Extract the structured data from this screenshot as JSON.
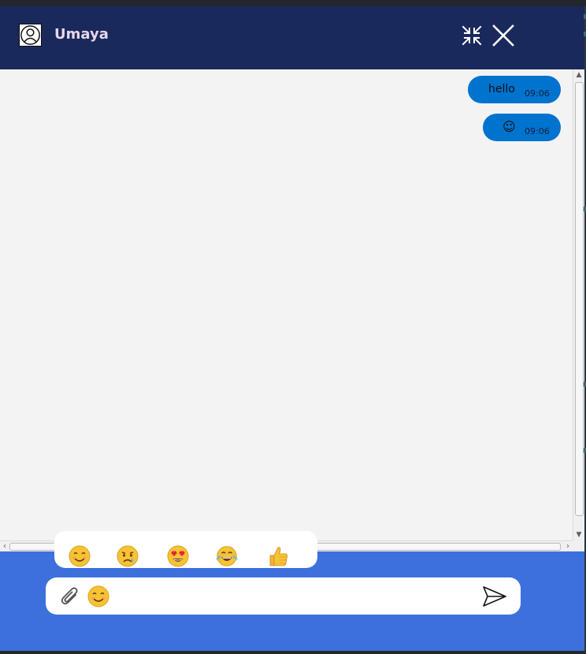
{
  "header": {
    "contact_name": "Umaya",
    "background_color": "#19295b"
  },
  "messages": [
    {
      "text": "hello",
      "time": "09:06",
      "direction": "outgoing"
    },
    {
      "text": "☺",
      "time": "09:06",
      "direction": "outgoing"
    }
  ],
  "emoji_picker": {
    "options": [
      "smiling-face-emoji",
      "sad-crying-face-emoji",
      "heart-eyes-face-emoji",
      "tears-of-joy-face-emoji",
      "thumbs-up-emoji"
    ]
  },
  "composer": {
    "message_value": "",
    "message_placeholder": "",
    "background_color": "#3d70dd"
  },
  "colors": {
    "bubble": "#0073cf",
    "chat_background": "#f3f3f3"
  }
}
